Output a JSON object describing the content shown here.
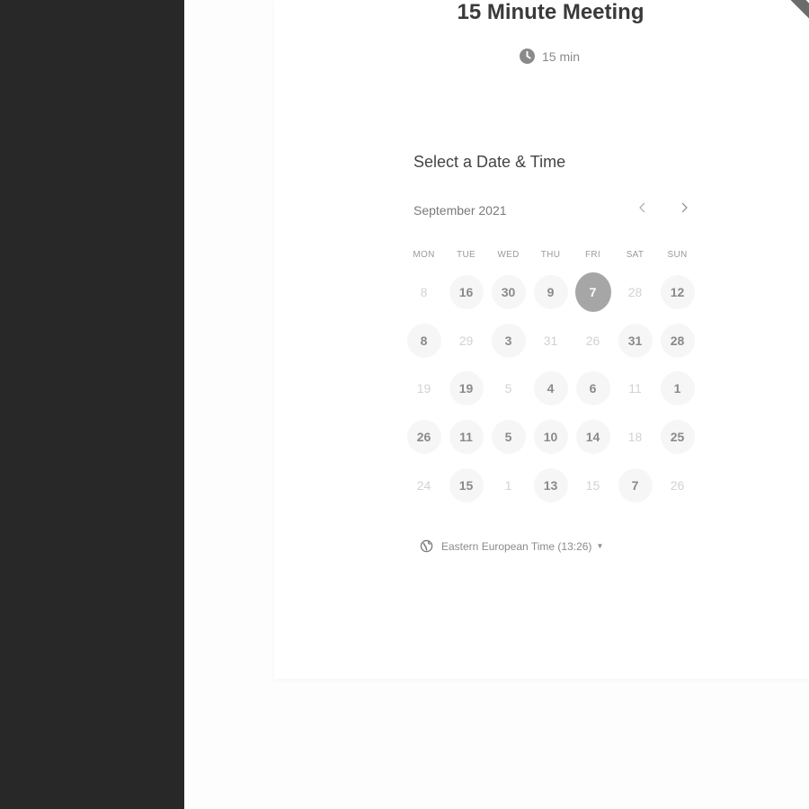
{
  "event": {
    "title": "15 Minute Meeting",
    "duration": "15 min"
  },
  "scheduler": {
    "heading": "Select a Date & Time",
    "month_label": "September 2021",
    "prev_icon": "chevron-left-icon",
    "next_icon": "chevron-right-icon",
    "weekdays": [
      "MON",
      "TUE",
      "WED",
      "THU",
      "FRI",
      "SAT",
      "SUN"
    ],
    "days": [
      {
        "label": "8",
        "state": "unavailable"
      },
      {
        "label": "16",
        "state": "available"
      },
      {
        "label": "30",
        "state": "available"
      },
      {
        "label": "9",
        "state": "available"
      },
      {
        "label": "7",
        "state": "selected"
      },
      {
        "label": "28",
        "state": "unavailable"
      },
      {
        "label": "12",
        "state": "available"
      },
      {
        "label": "8",
        "state": "available"
      },
      {
        "label": "29",
        "state": "unavailable"
      },
      {
        "label": "3",
        "state": "available"
      },
      {
        "label": "31",
        "state": "unavailable"
      },
      {
        "label": "26",
        "state": "unavailable"
      },
      {
        "label": "31",
        "state": "available"
      },
      {
        "label": "28",
        "state": "available"
      },
      {
        "label": "19",
        "state": "unavailable"
      },
      {
        "label": "19",
        "state": "available"
      },
      {
        "label": "5",
        "state": "unavailable"
      },
      {
        "label": "4",
        "state": "available"
      },
      {
        "label": "6",
        "state": "available"
      },
      {
        "label": "11",
        "state": "unavailable"
      },
      {
        "label": "1",
        "state": "available"
      },
      {
        "label": "26",
        "state": "available"
      },
      {
        "label": "11",
        "state": "available"
      },
      {
        "label": "5",
        "state": "available"
      },
      {
        "label": "10",
        "state": "available"
      },
      {
        "label": "14",
        "state": "available"
      },
      {
        "label": "18",
        "state": "unavailable"
      },
      {
        "label": "25",
        "state": "available"
      },
      {
        "label": "24",
        "state": "unavailable"
      },
      {
        "label": "15",
        "state": "available"
      },
      {
        "label": "1",
        "state": "unavailable"
      },
      {
        "label": "13",
        "state": "available"
      },
      {
        "label": "15",
        "state": "unavailable"
      },
      {
        "label": "7",
        "state": "available"
      },
      {
        "label": "26",
        "state": "unavailable"
      }
    ],
    "timezone": "Eastern European Time (13:26)"
  },
  "colors": {
    "sidebar_bg": "#282828",
    "selected_day_bg": "#a6a6a6",
    "available_day_bg": "#f6f6f6"
  }
}
